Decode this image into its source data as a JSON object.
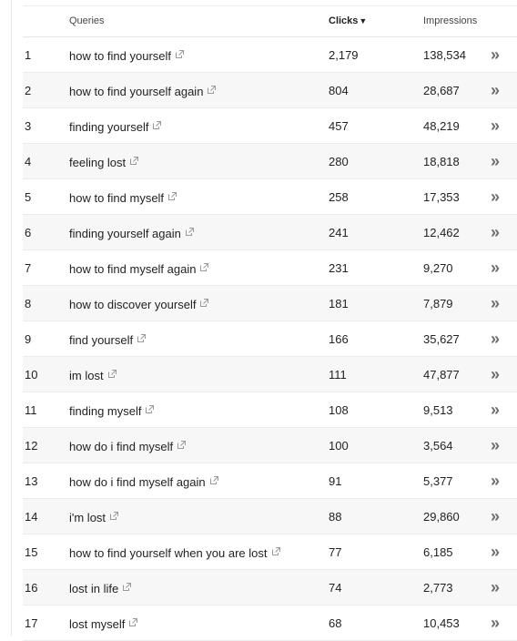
{
  "table": {
    "headers": {
      "query": "Queries",
      "clicks": "Clicks",
      "clicks_sort_indicator": "▼",
      "impressions": "Impressions"
    },
    "rows": [
      {
        "rank": "1",
        "query": "how to find yourself",
        "clicks": "2,179",
        "impressions": "138,534"
      },
      {
        "rank": "2",
        "query": "how to find yourself again",
        "clicks": "804",
        "impressions": "28,687"
      },
      {
        "rank": "3",
        "query": "finding yourself",
        "clicks": "457",
        "impressions": "48,219"
      },
      {
        "rank": "4",
        "query": "feeling lost",
        "clicks": "280",
        "impressions": "18,818"
      },
      {
        "rank": "5",
        "query": "how to find myself",
        "clicks": "258",
        "impressions": "17,353"
      },
      {
        "rank": "6",
        "query": "finding yourself again",
        "clicks": "241",
        "impressions": "12,462"
      },
      {
        "rank": "7",
        "query": "how to find myself again",
        "clicks": "231",
        "impressions": "9,270"
      },
      {
        "rank": "8",
        "query": "how to discover yourself",
        "clicks": "181",
        "impressions": "7,879"
      },
      {
        "rank": "9",
        "query": "find yourself",
        "clicks": "166",
        "impressions": "35,627"
      },
      {
        "rank": "10",
        "query": "im lost",
        "clicks": "111",
        "impressions": "47,877"
      },
      {
        "rank": "11",
        "query": "finding myself",
        "clicks": "108",
        "impressions": "9,513"
      },
      {
        "rank": "12",
        "query": "how do i find myself",
        "clicks": "100",
        "impressions": "3,564"
      },
      {
        "rank": "13",
        "query": "how do i find myself again",
        "clicks": "91",
        "impressions": "5,377"
      },
      {
        "rank": "14",
        "query": "i'm lost",
        "clicks": "88",
        "impressions": "29,860"
      },
      {
        "rank": "15",
        "query": "how to find yourself when you are lost",
        "clicks": "77",
        "impressions": "6,185"
      },
      {
        "rank": "16",
        "query": "lost in life",
        "clicks": "74",
        "impressions": "2,773"
      },
      {
        "rank": "17",
        "query": "lost myself",
        "clicks": "68",
        "impressions": "10,453"
      }
    ],
    "row_action_icon": "double-chevron-right-icon",
    "row_action_glyph": "»",
    "query_link_icon": "external-link-icon"
  },
  "colors": {
    "row_alt_bg": "#f7f7f7",
    "chevron": "#6e6e6e",
    "link_icon": "#9a9a9a"
  }
}
